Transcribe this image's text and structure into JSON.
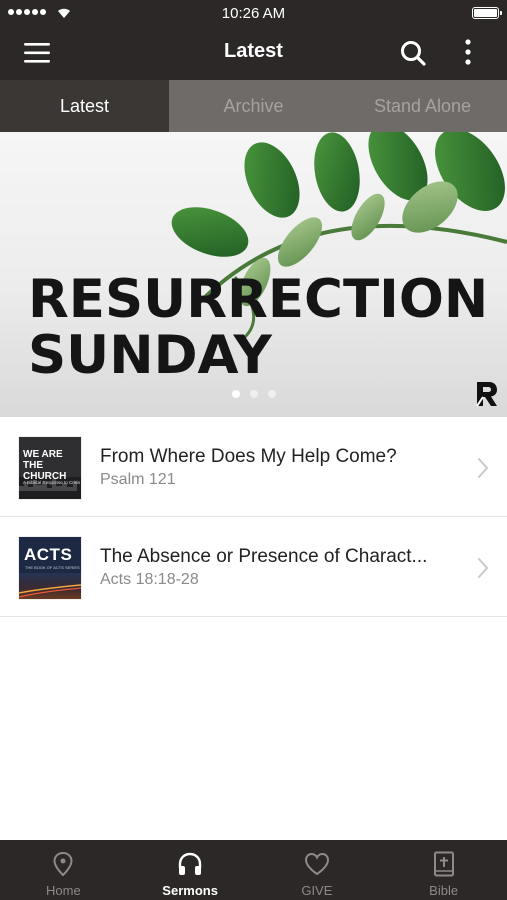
{
  "status_bar": {
    "time": "10:26 AM"
  },
  "nav": {
    "title": "Latest",
    "menu_icon": "hamburger-menu-icon",
    "search_icon": "search-icon",
    "more_icon": "more-vertical-icon"
  },
  "tabs": [
    {
      "label": "Latest",
      "active": true
    },
    {
      "label": "Archive",
      "active": false
    },
    {
      "label": "Stand Alone",
      "active": false
    }
  ],
  "hero": {
    "line1": "RESURRECTION",
    "line2": "SUNDAY",
    "page_count": 3,
    "active_page": 1,
    "logo_letter": "R"
  },
  "sermons": [
    {
      "title": "From Where Does My Help Come?",
      "subtitle": "Psalm 121",
      "thumb_text": "WE ARE THE CHURCH",
      "thumb_subtext": "A Biblical Response to Crisis"
    },
    {
      "title": "The Absence or Presence of Charact...",
      "subtitle": "Acts 18:18-28",
      "thumb_text": "ACTS",
      "thumb_subtext": "THE BOOK OF ACTS SERIES"
    }
  ],
  "bottom_tabs": [
    {
      "label": "Home",
      "icon": "map-pin-icon",
      "active": false
    },
    {
      "label": "Sermons",
      "icon": "headphones-icon",
      "active": true
    },
    {
      "label": "GIVE",
      "icon": "heart-icon",
      "active": false
    },
    {
      "label": "Bible",
      "icon": "bible-icon",
      "active": false
    }
  ],
  "colors": {
    "bar_background": "#2b2827",
    "active_tab": "#3a3735",
    "inactive_tab": "#6e6b69",
    "inactive_icon": "#8d8a88"
  }
}
